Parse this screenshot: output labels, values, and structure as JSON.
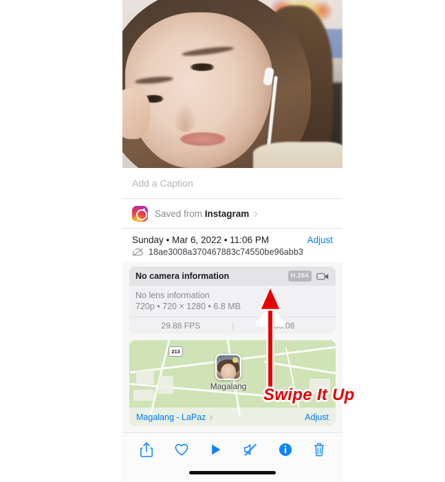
{
  "photo": {
    "alt_name": "selfie-photo"
  },
  "caption": {
    "placeholder": "Add a Caption",
    "value": ""
  },
  "source": {
    "icon": "instagram-icon",
    "prefix": "Saved from ",
    "app": "Instagram",
    "chevron": "chevron-right-icon"
  },
  "metadata": {
    "date": "Sunday • Mar 6, 2022 • 11:06 PM",
    "adjust_label": "Adjust",
    "cloud_icon": "cloud-slash-icon",
    "asset_id": "18ae3008a370467883c74550be96abb3"
  },
  "camera": {
    "title": "No camera information",
    "codec_badge": "H.264",
    "video_icon": "video-camera-icon",
    "lens": "No lens information",
    "specs": "720p • 720 × 1280 • 6.8 MB",
    "fps": "29.88 FPS",
    "duration": "00:08"
  },
  "map": {
    "route_shield": "213",
    "place_label": "Magalang",
    "pin_icon": "photo-pin-icon",
    "link_label": "Magalang - LaPaz",
    "chevron": "chevron-right-icon",
    "adjust_label": "Adjust"
  },
  "toolbar": {
    "items": [
      {
        "name": "share-icon",
        "label": "Share"
      },
      {
        "name": "heart-icon",
        "label": "Favorite"
      },
      {
        "name": "play-icon",
        "label": "Play"
      },
      {
        "name": "speaker-mute-icon",
        "label": "Mute"
      },
      {
        "name": "info-icon",
        "label": "Info"
      },
      {
        "name": "trash-icon",
        "label": "Delete"
      }
    ],
    "home_indicator": "home-indicator"
  },
  "annotation": {
    "arrow": "swipe-up-arrow",
    "text": "Swipe It Up"
  },
  "colors": {
    "accent_blue": "#007aff",
    "annotation_red": "#e60000",
    "page_bg": "#f7f7f7"
  }
}
